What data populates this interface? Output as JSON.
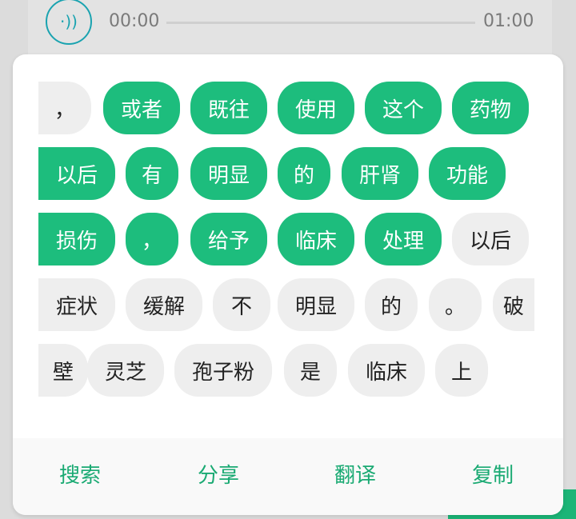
{
  "player": {
    "current_time": "00:00",
    "total_time": "01:00",
    "play_icon": "audio-play-icon",
    "progress": 0
  },
  "colors": {
    "selected_chip": "#1dbd7d",
    "unselected_chip": "#eeeeee",
    "action_text": "#1aaa73"
  },
  "chips": [
    {
      "text": "，",
      "selected": false
    },
    {
      "text": "或者",
      "selected": true
    },
    {
      "text": "既往",
      "selected": true
    },
    {
      "text": "使用",
      "selected": true
    },
    {
      "text": "这个",
      "selected": true
    },
    {
      "text": "药物",
      "selected": true
    },
    {
      "text": "以后",
      "selected": true
    },
    {
      "text": "有",
      "selected": true
    },
    {
      "text": "明显",
      "selected": true
    },
    {
      "text": "的",
      "selected": true
    },
    {
      "text": "肝肾",
      "selected": true
    },
    {
      "text": "功能",
      "selected": true
    },
    {
      "text": "损伤",
      "selected": true
    },
    {
      "text": "，",
      "selected": true
    },
    {
      "text": "给予",
      "selected": true
    },
    {
      "text": "临床",
      "selected": true
    },
    {
      "text": "处理",
      "selected": true
    },
    {
      "text": "以后",
      "selected": false
    },
    {
      "text": "症状",
      "selected": false
    },
    {
      "text": "缓解",
      "selected": false
    },
    {
      "text": "不",
      "selected": false
    },
    {
      "text": "明显",
      "selected": false
    },
    {
      "text": "的",
      "selected": false
    },
    {
      "text": "。",
      "selected": false
    },
    {
      "text": "破",
      "selected": false
    },
    {
      "text": "壁",
      "selected": false
    },
    {
      "text": "灵芝",
      "selected": false
    },
    {
      "text": "孢子粉",
      "selected": false
    },
    {
      "text": "是",
      "selected": false
    },
    {
      "text": "临床",
      "selected": false
    },
    {
      "text": "上",
      "selected": false
    }
  ],
  "actions": {
    "search": "搜索",
    "share": "分享",
    "translate": "翻译",
    "copy": "复制"
  }
}
